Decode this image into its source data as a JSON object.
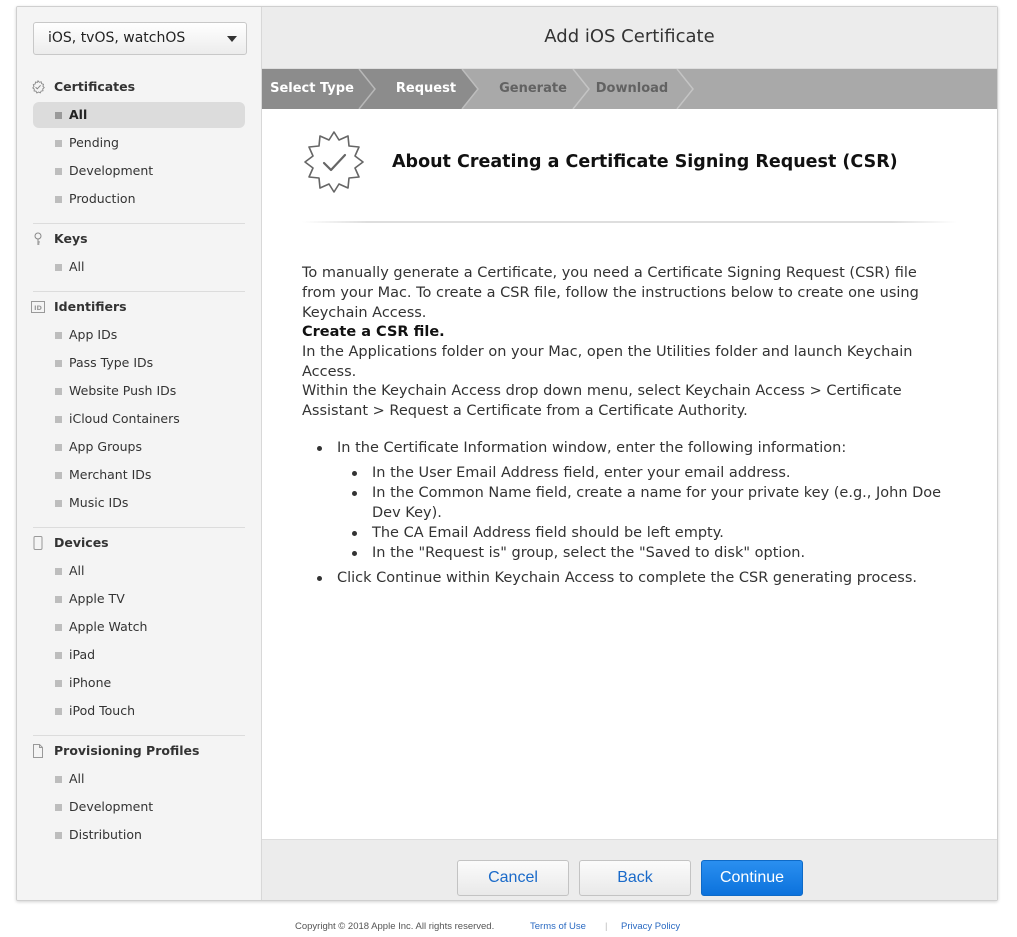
{
  "sidebar": {
    "platform": "iOS, tvOS, watchOS",
    "sections": [
      {
        "title": "Certificates",
        "icon": "certificate-icon",
        "items": [
          "All",
          "Pending",
          "Development",
          "Production"
        ]
      },
      {
        "title": "Keys",
        "icon": "key-icon",
        "items": [
          "All"
        ]
      },
      {
        "title": "Identifiers",
        "icon": "id-icon",
        "items": [
          "App IDs",
          "Pass Type IDs",
          "Website Push IDs",
          "iCloud Containers",
          "App Groups",
          "Merchant IDs",
          "Music IDs"
        ]
      },
      {
        "title": "Devices",
        "icon": "device-icon",
        "items": [
          "All",
          "Apple TV",
          "Apple Watch",
          "iPad",
          "iPhone",
          "iPod Touch"
        ]
      },
      {
        "title": "Provisioning Profiles",
        "icon": "document-icon",
        "items": [
          "All",
          "Development",
          "Distribution"
        ]
      }
    ],
    "active_item": "Certificates / All"
  },
  "header": {
    "title": "Add iOS Certificate"
  },
  "steps": [
    {
      "label": "Select Type",
      "state": "done"
    },
    {
      "label": "Request",
      "state": "current"
    },
    {
      "label": "Generate",
      "state": "todo"
    },
    {
      "label": "Download",
      "state": "todo"
    }
  ],
  "content": {
    "title": "About Creating a Certificate Signing Request (CSR)",
    "intro": "To manually generate a Certificate, you need a Certificate Signing Request (CSR) file from your Mac. To create a CSR file, follow the instructions below to create one using Keychain Access.",
    "create_heading": "Create a CSR file.",
    "create_text": "In the Applications folder on your Mac, open the Utilities folder and launch Keychain Access.",
    "menu_text": "Within the Keychain Access drop down menu, select Keychain Access > Certificate Assistant > Request a Certificate from a Certificate Authority.",
    "bullet1": "In the Certificate Information window, enter the following information:",
    "sub_bullets": [
      "In the User Email Address field, enter your email address.",
      "In the Common Name field, create a name for your private key (e.g., John Doe Dev Key).",
      "The CA Email Address field should be left empty.",
      "In the \"Request is\" group, select the \"Saved to disk\" option."
    ],
    "bullet2": "Click Continue within Keychain Access to complete the CSR generating process."
  },
  "buttons": {
    "cancel": "Cancel",
    "back": "Back",
    "continue": "Continue"
  },
  "footer": {
    "copyright": "Copyright © 2018 Apple Inc. All rights reserved.",
    "terms": "Terms of Use",
    "separator": "|",
    "privacy": "Privacy Policy"
  },
  "colors": {
    "accent": "#0c72dc",
    "link": "#2a6ac2",
    "steps_bar": "#a9a9a9"
  }
}
